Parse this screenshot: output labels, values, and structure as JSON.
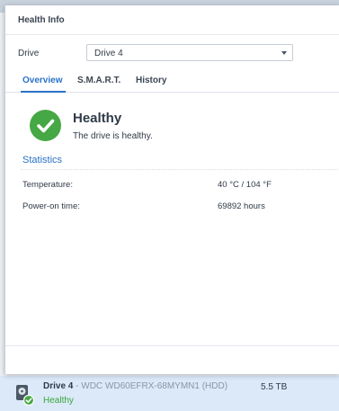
{
  "dialog": {
    "title": "Health Info",
    "drive_label": "Drive",
    "drive_select": {
      "value": "Drive 4"
    },
    "tabs": [
      {
        "label": "Overview",
        "active": true
      },
      {
        "label": "S.M.A.R.T.",
        "active": false
      },
      {
        "label": "History",
        "active": false
      }
    ],
    "status": {
      "icon": "check-icon",
      "title": "Healthy",
      "description": "The drive is healthy.",
      "color": "#46a844"
    },
    "statistics": {
      "title": "Statistics",
      "rows": [
        {
          "label": "Temperature:",
          "value": "40 °C / 104 °F"
        },
        {
          "label": "Power-on time:",
          "value": "69892 hours"
        }
      ]
    }
  },
  "background_list": {
    "drive": {
      "name": "Drive 4",
      "separator": " - ",
      "model": "WDC WD60EFRX-68MYMN1 (HDD)",
      "size": "5.5 TB",
      "status": "Healthy",
      "status_color": "#3aa63a",
      "icon": "hard-drive-icon"
    }
  },
  "colors": {
    "accent": "#2a72c7",
    "success": "#46a844"
  }
}
